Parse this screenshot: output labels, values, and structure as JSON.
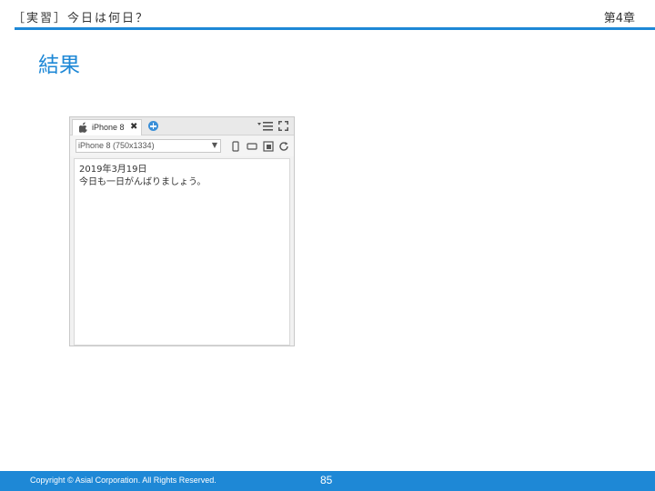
{
  "header": {
    "title": "［実習］今日は何日？",
    "chapter": "第4章"
  },
  "section": {
    "title": "結果"
  },
  "simulator": {
    "tab_label": "iPhone 8",
    "device_select": "iPhone 8 (750x1334)",
    "screen_lines": [
      "2019年3月19日",
      "今日も一日がんばりましょう。"
    ],
    "icons": [
      "apple-icon",
      "close-icon",
      "add-icon",
      "menu-icon",
      "expand-icon",
      "portrait-icon",
      "landscape-icon",
      "screenshot-icon",
      "refresh-icon"
    ],
    "accent_color": "#3a8fd8"
  },
  "footer": {
    "copyright": "Copyright © Asial Corporation. All Rights Reserved.",
    "page_number": "85",
    "color": "#1e88d6"
  }
}
